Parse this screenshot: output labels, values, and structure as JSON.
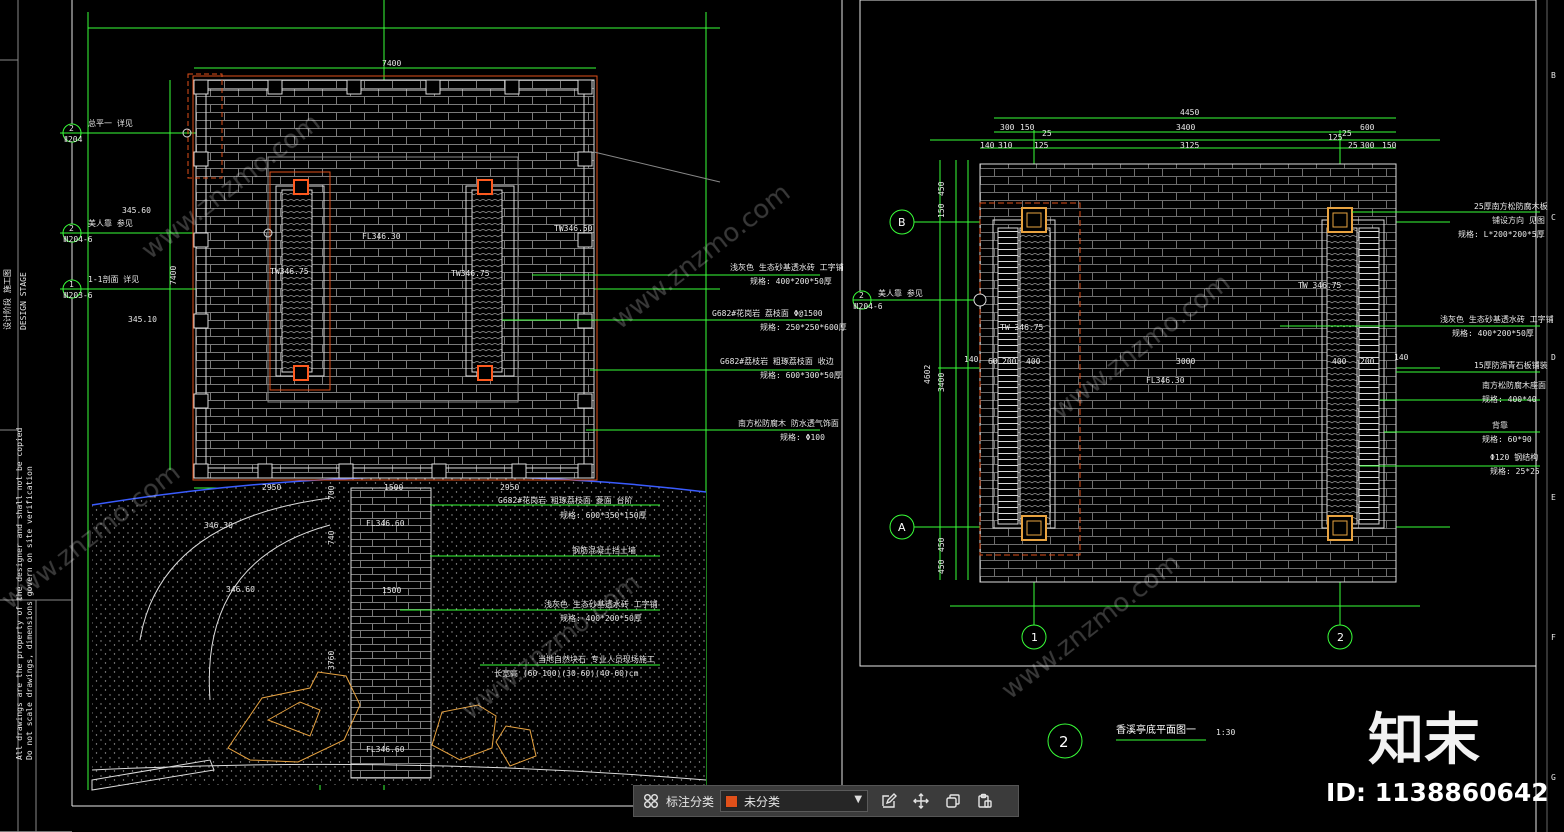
{
  "drawing": {
    "left_plan": {
      "width_dim": "7400",
      "height_dim": "7400",
      "bottom_dims": [
        "2950",
        "1500",
        "2950"
      ],
      "path_dims": [
        "700",
        "740",
        "1500",
        "3760"
      ],
      "fl_center": "FL346.30",
      "tw_right": "TW346.50",
      "tw_left_bench": "TW346.75",
      "tw_right_bench": "TW346.75",
      "fl_path_top": "FL346.60",
      "fl_path_mid": "1500",
      "fl_path_bottom": "FL346.60",
      "elev_a": "345.60",
      "elev_b": "345.10",
      "elev_c": "346.30",
      "elev_d": "346.60",
      "left_markers": [
        {
          "num": "2",
          "code": "Ⅱ204",
          "text": "总平一 详见"
        },
        {
          "num": "2",
          "code": "Ⅲ204-6",
          "text": "美人靠 参见"
        },
        {
          "num": "1",
          "code": "Ⅲ203-6",
          "text": "1-1剖面 详见"
        }
      ],
      "notes": [
        {
          "l1": "浅灰色 生态砂基透水砖 工字铺",
          "l2": "规格: 400*200*50厚"
        },
        {
          "l1": "G682#花岗岩 荔枝面 Φ@1500",
          "l2": "规格: 250*250*600厚"
        },
        {
          "l1": "G682#荔枝岩 粗琢荔枝面 收边",
          "l2": "规格: 600*300*50厚"
        },
        {
          "l1": "南方松防腐木 防水透气饰面",
          "l2": "规格: Φ100"
        },
        {
          "l1": "G682#花岗岩 粗琢荔枝面 菱面 台阶",
          "l2": "规格: 600*350*150厚"
        },
        {
          "l1": "钢筋混凝土挡土墙",
          "l2": ""
        },
        {
          "l1": "浅灰色 生态砂基透水砖 工字铺",
          "l2": "规格: 400*200*50厚"
        },
        {
          "l1": "当地自然块石 专业人员现场施工",
          "l2": "长宽高 (60-100)(30-60)(40-60)cm"
        }
      ]
    },
    "right_plan": {
      "top_dims_1": [
        "4450"
      ],
      "top_dims_2": [
        "300",
        "150",
        "25",
        "3400",
        "125",
        "25",
        "600"
      ],
      "top_dims_3": [
        "140",
        "310",
        "125",
        "3125",
        "25",
        "300",
        "150"
      ],
      "left_dims": [
        "450",
        "150",
        "3400",
        "4602",
        "450",
        "450"
      ],
      "mid_dims": [
        "140",
        "60",
        "200",
        "400",
        "3000",
        "400",
        "200",
        "140"
      ],
      "fl": "FL346.30",
      "tw_left": "TW 346.75",
      "tw_right": "TW 346.75",
      "axis_b": "B",
      "axis_a": "A",
      "axis_1": "1",
      "axis_2": "2",
      "marker": {
        "num": "2",
        "code": "Ⅲ204-6",
        "text": "美人靠 参见"
      },
      "notes": [
        {
          "l1": "25厚南方松防腐木板",
          "l2": "铺设方向 见图",
          "l3": "规格: L*200*200*5厚"
        },
        {
          "l1": "浅灰色 生态砂基透水砖 工字铺",
          "l2": "规格: 400*200*50厚",
          "l3": ""
        },
        {
          "l1": "15厚防滑青石板铺装",
          "l2": "",
          "l3": ""
        },
        {
          "l1": "南方松防腐木座面",
          "l2": "规格: 400*40",
          "l3": ""
        },
        {
          "l1": "背靠",
          "l2": "规格: 60*90",
          "l3": ""
        },
        {
          "l1": "Φ120 钢结构",
          "l2": "规格: 25*25",
          "l3": ""
        }
      ],
      "title_num": "2",
      "title": "香溪亭底平面图一",
      "scale": "1:30"
    },
    "border_letters": [
      "B",
      "C",
      "D",
      "E",
      "F",
      "G"
    ]
  },
  "toolbar": {
    "label": "标注分类",
    "selected": "未分类",
    "swatch_color": "#e0501a"
  },
  "watermark": {
    "logo": "知末",
    "id": "ID: 1138860642",
    "url": "www.znzmo.com",
    "brand": "知末网"
  },
  "colors": {
    "background": "#000000",
    "dim": "#39ff39",
    "line": "#e6e6e6",
    "accent_orange": "#ff5a1f",
    "blue": "#3a5cff",
    "hatch": "#8a8a8a"
  }
}
